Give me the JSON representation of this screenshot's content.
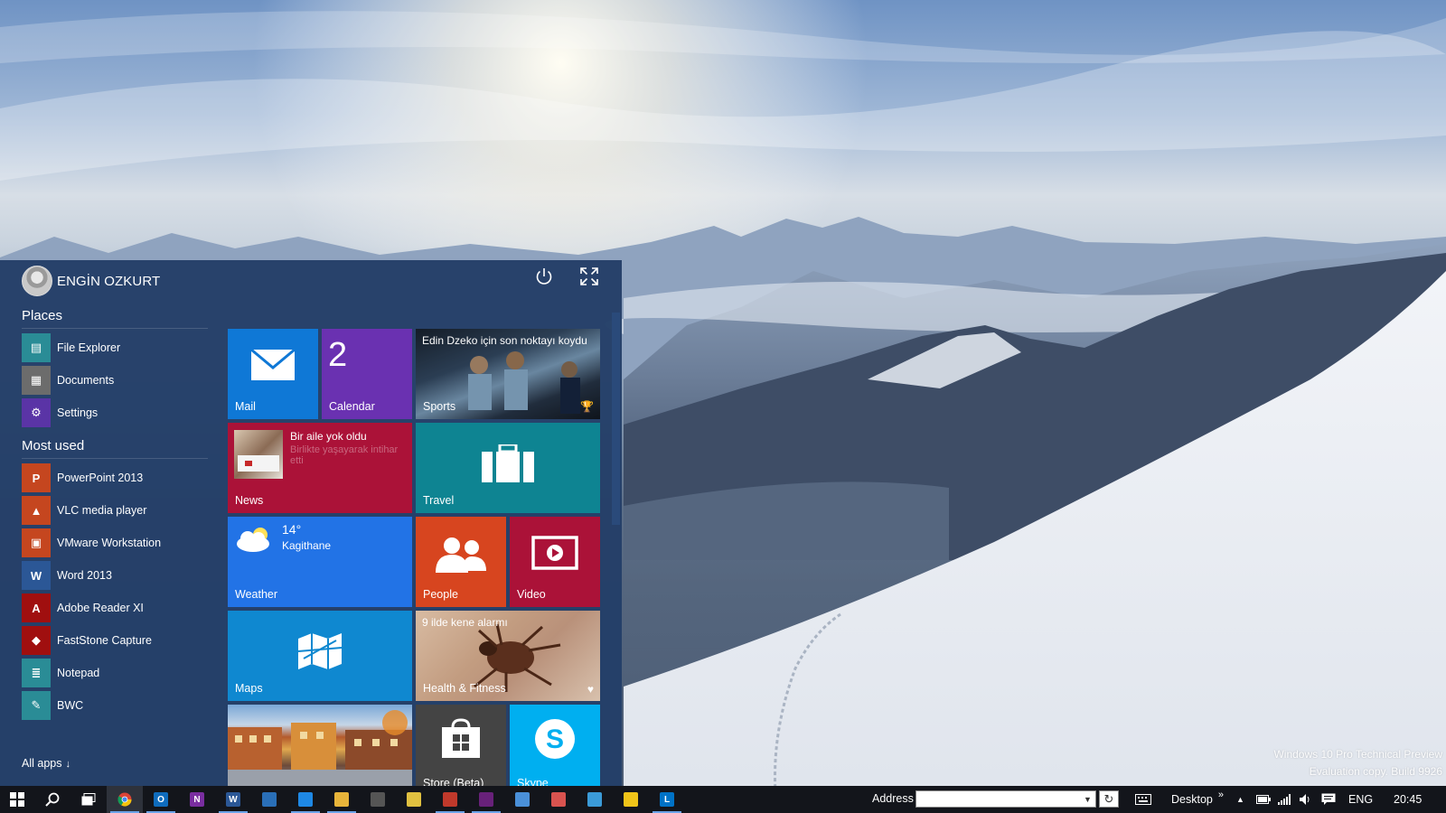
{
  "user": {
    "name": "ENGİN OZKURT"
  },
  "power": {
    "icon": "power-icon"
  },
  "expand": {
    "icon": "expand-icon"
  },
  "places": {
    "title": "Places",
    "items": [
      {
        "label": "File Explorer",
        "icon": "folder-icon",
        "color": "#2a8c96"
      },
      {
        "label": "Documents",
        "icon": "documents-icon",
        "color": "#6c6c6c"
      },
      {
        "label": "Settings",
        "icon": "gear-icon",
        "color": "#5a34a6"
      }
    ]
  },
  "most_used": {
    "title": "Most used",
    "items": [
      {
        "label": "PowerPoint 2013",
        "icon": "powerpoint-icon",
        "color": "#c5461f"
      },
      {
        "label": "VLC media player",
        "icon": "vlc-icon",
        "color": "#c5461f"
      },
      {
        "label": "VMware Workstation",
        "icon": "vmware-icon",
        "color": "#c5461f"
      },
      {
        "label": "Word 2013",
        "icon": "word-icon",
        "color": "#2b5796"
      },
      {
        "label": "Adobe Reader XI",
        "icon": "adobe-reader-icon",
        "color": "#a00f0f"
      },
      {
        "label": "FastStone Capture",
        "icon": "faststone-icon",
        "color": "#a00f0f"
      },
      {
        "label": "Notepad",
        "icon": "notepad-icon",
        "color": "#2a8c96"
      },
      {
        "label": "BWC",
        "icon": "bwc-icon",
        "color": "#2a8c96"
      }
    ]
  },
  "all_apps": {
    "label": "All apps",
    "arrow": "↓"
  },
  "tiles": {
    "mail": {
      "label": "Mail",
      "color": "#0f78d6"
    },
    "calendar": {
      "label": "Calendar",
      "number": "2",
      "color": "#6a31b1"
    },
    "sports": {
      "label": "Sports",
      "headline": "Edin Dzeko için son noktayı koydu"
    },
    "news": {
      "label": "News",
      "headline": "Bir aile yok oldu",
      "subline": "Birlikte yaşayarak intihar etti",
      "color": "#ab1238"
    },
    "travel": {
      "label": "Travel",
      "color": "#0e8492"
    },
    "weather": {
      "label": "Weather",
      "temp": "14°",
      "city": "Kagithane",
      "color": "#2273e6"
    },
    "people": {
      "label": "People",
      "color": "#d7451f"
    },
    "video": {
      "label": "Video",
      "color": "#ab1238"
    },
    "maps": {
      "label": "Maps",
      "color": "#0f88d0"
    },
    "health": {
      "label": "Health & Fitness",
      "headline": "9 ilde kene alarmı"
    },
    "photo": {
      "label": ""
    },
    "store": {
      "label": "Store (Beta)",
      "color": "#444444"
    },
    "skype": {
      "label": "Skype",
      "color": "#00aff0"
    }
  },
  "taskbar": {
    "apps": [
      {
        "icon": "start-windows-icon"
      },
      {
        "icon": "search-icon"
      },
      {
        "icon": "task-view-icon"
      },
      {
        "icon": "chrome-icon"
      },
      {
        "icon": "outlook-icon"
      },
      {
        "icon": "onenote-icon"
      },
      {
        "icon": "word-icon"
      },
      {
        "icon": "powershell-icon"
      },
      {
        "icon": "app-blue-icon"
      },
      {
        "icon": "file-explorer-icon"
      },
      {
        "icon": "store-icon"
      },
      {
        "icon": "photos-icon"
      },
      {
        "icon": "faststone-icon"
      },
      {
        "icon": "visual-studio-icon"
      },
      {
        "icon": "remote-desktop-icon"
      },
      {
        "icon": "paint-icon"
      },
      {
        "icon": "media-icon"
      },
      {
        "icon": "sticky-icon"
      },
      {
        "icon": "lync-icon"
      }
    ],
    "address_label": "Address",
    "desktop_label": "Desktop",
    "language": "ENG",
    "time": "20:45"
  },
  "watermark": {
    "line1": "Windows 10 Pro Technical Preview",
    "line2": "Evaluation copy. Build 9926"
  }
}
